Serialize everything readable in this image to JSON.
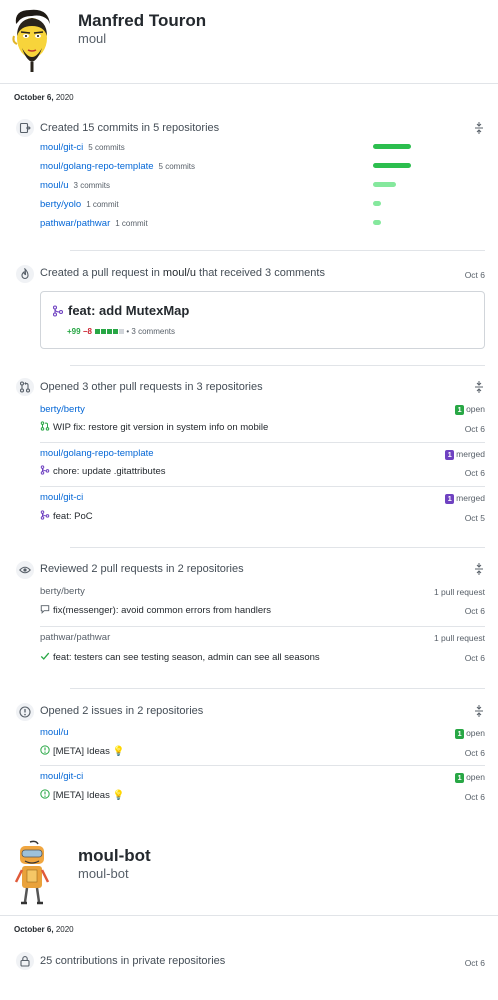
{
  "users": [
    {
      "name": "Manfred Touron",
      "login": "moul",
      "date_month_day": "October 6,",
      "date_year": "2020"
    },
    {
      "name": "moul-bot",
      "login": "moul-bot",
      "date_month_day": "October 6,",
      "date_year": "2020"
    }
  ],
  "commits": {
    "title": "Created 15 commits in 5 repositories",
    "repos": [
      {
        "name": "moul/git-ci",
        "count": "5 commits",
        "share": 1.0
      },
      {
        "name": "moul/golang-repo-template",
        "count": "5 commits",
        "share": 1.0
      },
      {
        "name": "moul/u",
        "count": "3 commits",
        "share": 0.6
      },
      {
        "name": "berty/yolo",
        "count": "1 commit",
        "share": 0.2
      },
      {
        "name": "pathwar/pathwar",
        "count": "1 commit",
        "share": 0.2
      }
    ],
    "bar_colors": [
      "#2cbe4e",
      "#2cbe4e",
      "#85e89d",
      "#85e89d",
      "#85e89d"
    ]
  },
  "pull_request": {
    "title_prefix": "Created a pull request in",
    "repo": "moul/u",
    "title_suffix": "that received 3 comments",
    "date": "Oct 6",
    "card_title": "feat: add MutexMap",
    "additions": "+99",
    "deletions": "−8",
    "comments": "• 3 comments"
  },
  "opened_prs": {
    "title": "Opened 3 other pull requests in 3 repositories",
    "items": [
      {
        "repo": "berty/berty",
        "badge": "1",
        "state": "open",
        "title": "WIP fix: restore git version in system info on mobile",
        "date": "Oct 6"
      },
      {
        "repo": "moul/golang-repo-template",
        "badge": "1",
        "state": "merged",
        "title": "chore: update .gitattributes",
        "date": "Oct 6"
      },
      {
        "repo": "moul/git-ci",
        "badge": "1",
        "state": "merged",
        "title": "feat: PoC",
        "date": "Oct 5"
      }
    ]
  },
  "reviews": {
    "title": "Reviewed 2 pull requests in 2 repositories",
    "items": [
      {
        "repo": "berty/berty",
        "count": "1 pull request",
        "title": "fix(messenger): avoid common errors from handlers",
        "date": "Oct 6",
        "icon": "comment-icon"
      },
      {
        "repo": "pathwar/pathwar",
        "count": "1 pull request",
        "title": "feat: testers can see testing season, admin can see all seasons",
        "date": "Oct 6",
        "icon": "check-icon"
      }
    ]
  },
  "issues": {
    "title": "Opened 2 issues in 2 repositories",
    "items": [
      {
        "repo": "moul/u",
        "badge": "1",
        "state": "open",
        "title": "[META] Ideas 💡",
        "date": "Oct 6"
      },
      {
        "repo": "moul/git-ci",
        "badge": "1",
        "state": "open",
        "title": "[META] Ideas 💡",
        "date": "Oct 6"
      }
    ]
  },
  "private": {
    "title": "25 contributions in private repositories",
    "date": "Oct 6"
  },
  "colors": {
    "link": "#0366d6",
    "green": "#28a745",
    "purple": "#6f42c1",
    "red": "#cb2431"
  }
}
